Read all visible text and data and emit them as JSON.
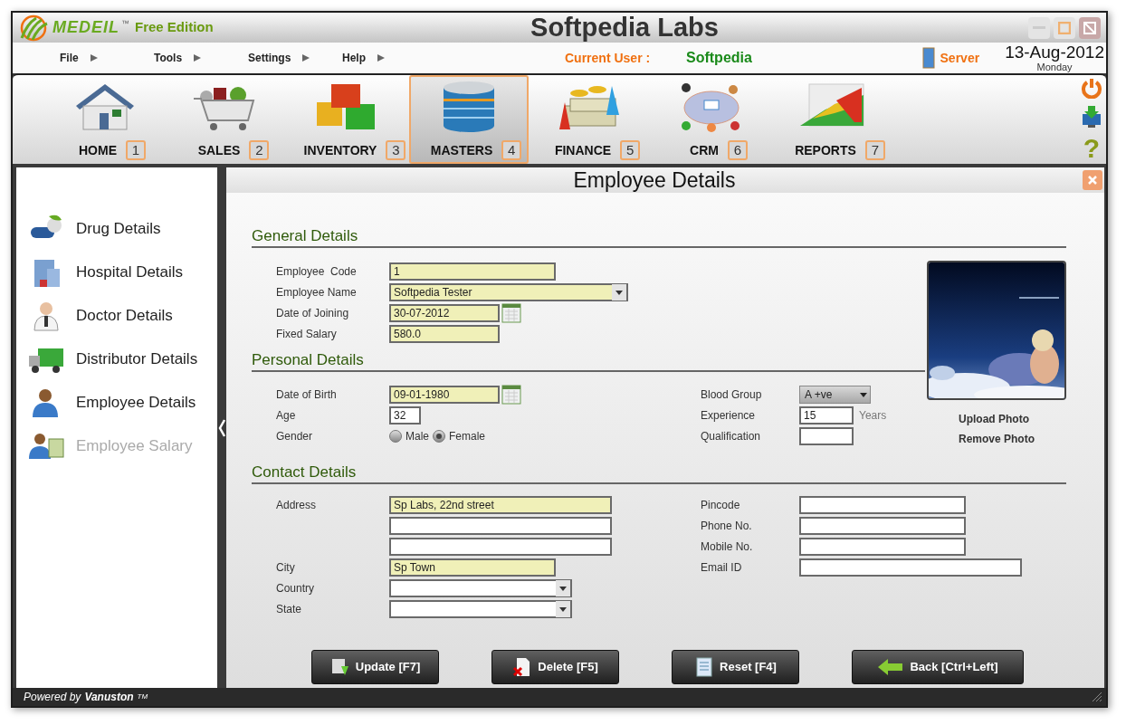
{
  "app": {
    "logo": "MEDEIL",
    "tm": "™",
    "edition": "Free Edition",
    "title": "Softpedia Labs"
  },
  "menu": [
    {
      "label": "File"
    },
    {
      "label": "Tools"
    },
    {
      "label": "Settings"
    },
    {
      "label": "Help"
    }
  ],
  "user": {
    "label": "Current User :",
    "name": "Softpedia"
  },
  "server": "Server",
  "date": "13-Aug-2012",
  "day": "Monday",
  "modules": [
    {
      "label": "HOME",
      "key": "1",
      "kind": "house",
      "selected": false
    },
    {
      "label": "SALES",
      "key": "2",
      "kind": "cart",
      "selected": false
    },
    {
      "label": "INVENTORY",
      "key": "3",
      "kind": "boxes",
      "selected": false
    },
    {
      "label": "MASTERS",
      "key": "4",
      "kind": "database",
      "selected": true
    },
    {
      "label": "FINANCE",
      "key": "5",
      "kind": "money",
      "selected": false
    },
    {
      "label": "CRM",
      "key": "6",
      "kind": "network",
      "selected": false
    },
    {
      "label": "REPORTS",
      "key": "7",
      "kind": "chart",
      "selected": false
    }
  ],
  "side_tools": [
    {
      "kind": "power"
    },
    {
      "kind": "download"
    },
    {
      "kind": "help",
      "label": "?"
    }
  ],
  "sidebar": {
    "items": [
      {
        "label": "Drug Details",
        "kind": "pills",
        "disabled": false
      },
      {
        "label": "Hospital Details",
        "kind": "building",
        "disabled": false
      },
      {
        "label": "Doctor Details",
        "kind": "doctor",
        "disabled": false
      },
      {
        "label": "Distributor Details",
        "kind": "truck",
        "disabled": false
      },
      {
        "label": "Employee Details",
        "kind": "person",
        "disabled": false
      },
      {
        "label": "Employee Salary",
        "kind": "salary",
        "disabled": true
      }
    ]
  },
  "panel": {
    "title": "Employee Details"
  },
  "general": {
    "title": "General Details",
    "fields": [
      {
        "label": "Employee  Code",
        "value": "1",
        "kind": "text",
        "required": true
      },
      {
        "label": "Employee Name",
        "value": "Softpedia Tester",
        "kind": "select",
        "required": true
      },
      {
        "label": "Date of Joining",
        "value": "30-07-2012",
        "kind": "date",
        "required": true
      },
      {
        "label": "Fixed Salary",
        "value": "580.0",
        "kind": "text",
        "required": true
      }
    ]
  },
  "personal": {
    "title": "Personal Details",
    "left": [
      {
        "label": "Date of Birth",
        "value": "09-01-1980",
        "kind": "date",
        "required": true
      },
      {
        "label": "Age",
        "value": "32",
        "kind": "text",
        "required": false
      },
      {
        "label": "Gender",
        "kind": "radio",
        "options": [
          {
            "label": "Male",
            "selected": false
          },
          {
            "label": "Female",
            "selected": true
          }
        ]
      }
    ],
    "right": [
      {
        "label": "Blood Group",
        "value": "A +ve",
        "kind": "dropdown",
        "required": false
      },
      {
        "label": "Experience",
        "value": "15",
        "suffix": "Years",
        "kind": "text",
        "required": false
      },
      {
        "label": "Qualification",
        "kind": "text",
        "required": false
      }
    ]
  },
  "photo": {
    "kind": "picture",
    "actions": [
      "Upload Photo",
      "Remove Photo"
    ]
  },
  "contact": {
    "title": "Contact Details",
    "left": [
      {
        "label": "Address",
        "value": "Sp Labs, 22nd street",
        "kind": "text",
        "required": true
      },
      {
        "kind": "text",
        "required": false
      },
      {
        "kind": "text",
        "required": false
      },
      {
        "label": "City",
        "value": "Sp Town",
        "kind": "text",
        "required": true
      },
      {
        "label": "Country",
        "kind": "select",
        "required": false
      },
      {
        "label": "State",
        "kind": "select",
        "required": false
      }
    ],
    "right": [
      {
        "label": "Pincode",
        "kind": "text",
        "required": false
      },
      {
        "label": "Phone No.",
        "kind": "text",
        "required": false
      },
      {
        "label": "Mobile No.",
        "kind": "text",
        "required": false
      },
      {
        "label": "Email ID",
        "kind": "text",
        "required": false
      }
    ]
  },
  "buttons": [
    {
      "label": "Update [F7]",
      "kind": "update"
    },
    {
      "label": "Delete [F5]",
      "kind": "delete"
    },
    {
      "label": "Reset [F4]",
      "kind": "reset"
    },
    {
      "label": "Back [Ctrl+Left]",
      "kind": "back"
    }
  ],
  "footer": {
    "prefix": "Powered by",
    "brand": "Vanuston",
    "tm": "TM"
  }
}
